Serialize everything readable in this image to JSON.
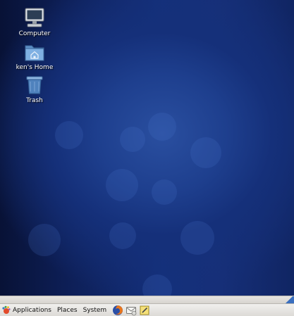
{
  "desktop": {
    "icons": [
      {
        "label": "Computer",
        "icon": "computer-icon"
      },
      {
        "label": "ken's Home",
        "icon": "home-folder-icon"
      },
      {
        "label": "Trash",
        "icon": "trash-icon"
      }
    ]
  },
  "panel": {
    "menus": [
      {
        "label": "Applications",
        "icon": "gnome-foot-icon"
      },
      {
        "label": "Places"
      },
      {
        "label": "System"
      }
    ],
    "launchers": [
      {
        "name": "firefox-icon"
      },
      {
        "name": "email-icon"
      },
      {
        "name": "note-editor-icon"
      }
    ]
  }
}
